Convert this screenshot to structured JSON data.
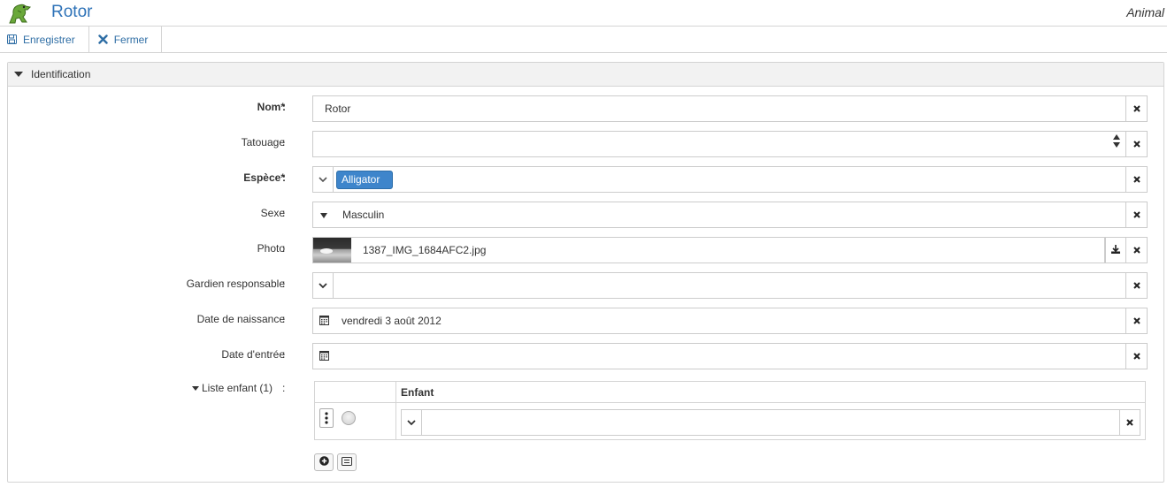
{
  "header": {
    "title": "Rotor",
    "entity": "Animal",
    "logo_icon": "dinosaur-icon"
  },
  "toolbar": {
    "save_label": "Enregistrer",
    "close_label": "Fermer"
  },
  "panel": {
    "title": "Identification"
  },
  "form": {
    "nom": {
      "label": "Nom*",
      "value": "Rotor"
    },
    "tatouage": {
      "label": "Tatouage",
      "value": ""
    },
    "espece": {
      "label": "Espèce*",
      "tag": "Alligator"
    },
    "sexe": {
      "label": "Sexe",
      "value": "Masculin"
    },
    "photo": {
      "label": "Photo",
      "filename": "1387_IMG_1684AFC2.jpg"
    },
    "gardien": {
      "label": "Gardien responsable",
      "value": ""
    },
    "naissance": {
      "label": "Date de naissance",
      "value": "vendredi 3 août 2012"
    },
    "entree": {
      "label": "Date d'entrée",
      "value": ""
    },
    "liste_enfant": {
      "label": "Liste enfant (1)",
      "column": "Enfant",
      "rows": [
        {
          "value": ""
        }
      ]
    }
  },
  "colors": {
    "accent": "#2f73b8",
    "tag": "#3e85cb"
  }
}
